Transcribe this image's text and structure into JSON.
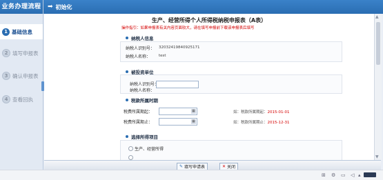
{
  "sidebar": {
    "title": "业务办理流程",
    "steps": [
      {
        "num": "1",
        "label": "基础信息"
      },
      {
        "num": "2",
        "label": "填写申报表"
      },
      {
        "num": "3",
        "label": "确认申报表"
      },
      {
        "num": "4",
        "label": "查看回执"
      }
    ]
  },
  "topbar": {
    "title": "初始化"
  },
  "form": {
    "title": "生产、经营所得个人所得税纳税申报表（A表）",
    "notice": "操作指引：如果申报表有关内容页面较大，请在填写申报前下载该申报表后填写",
    "taxpayer_section": "纳税人信息",
    "taxpayer_id_label": "纳税人识别号：",
    "taxpayer_id_value": "32032419840925171",
    "taxpayer_name_label": "纳税人名称：",
    "taxpayer_name_value": "test",
    "invested_section": "被投资单位",
    "invested_id_label": "纳税人识别号：",
    "invested_name_label": "纳税人名称：",
    "period_section": "税款所属时期",
    "period_start_label": "税费所属期起：",
    "period_end_label": "税费所属期止：",
    "period_start_hint_prefix": "如：税款所属期起：",
    "period_start_hint_value": "2015-01-01",
    "period_end_hint_prefix": "如：税款所属期止：",
    "period_end_hint_value": "2015-12-31",
    "income_section": "选择所得项目",
    "income_option_1": "生产、经营所得"
  },
  "buttons": {
    "fill": "填写申请表",
    "close": "关闭"
  },
  "colors": {
    "header_blue": "#2a6db2",
    "notice_red": "#d40000",
    "panel_bg": "#e2e9f3"
  }
}
